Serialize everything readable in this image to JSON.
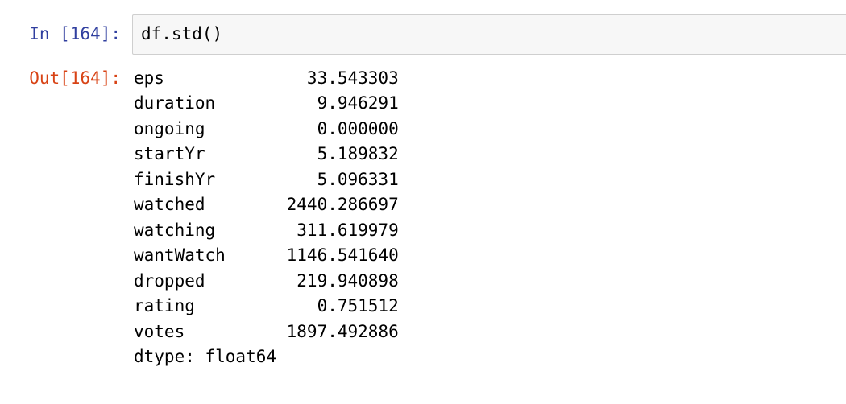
{
  "input": {
    "prompt": "In [164]:",
    "code": "df.std()"
  },
  "output": {
    "prompt": "Out[164]:",
    "series": [
      {
        "name": "eps",
        "value": "33.543303"
      },
      {
        "name": "duration",
        "value": "9.946291"
      },
      {
        "name": "ongoing",
        "value": "0.000000"
      },
      {
        "name": "startYr",
        "value": "5.189832"
      },
      {
        "name": "finishYr",
        "value": "5.096331"
      },
      {
        "name": "watched",
        "value": "2440.286697"
      },
      {
        "name": "watching",
        "value": "311.619979"
      },
      {
        "name": "wantWatch",
        "value": "1146.541640"
      },
      {
        "name": "dropped",
        "value": "219.940898"
      },
      {
        "name": "rating",
        "value": "0.751512"
      },
      {
        "name": "votes",
        "value": "1897.492886"
      }
    ],
    "dtype_line": "dtype: float64"
  },
  "format": {
    "name_width": 12,
    "value_width": 14
  }
}
